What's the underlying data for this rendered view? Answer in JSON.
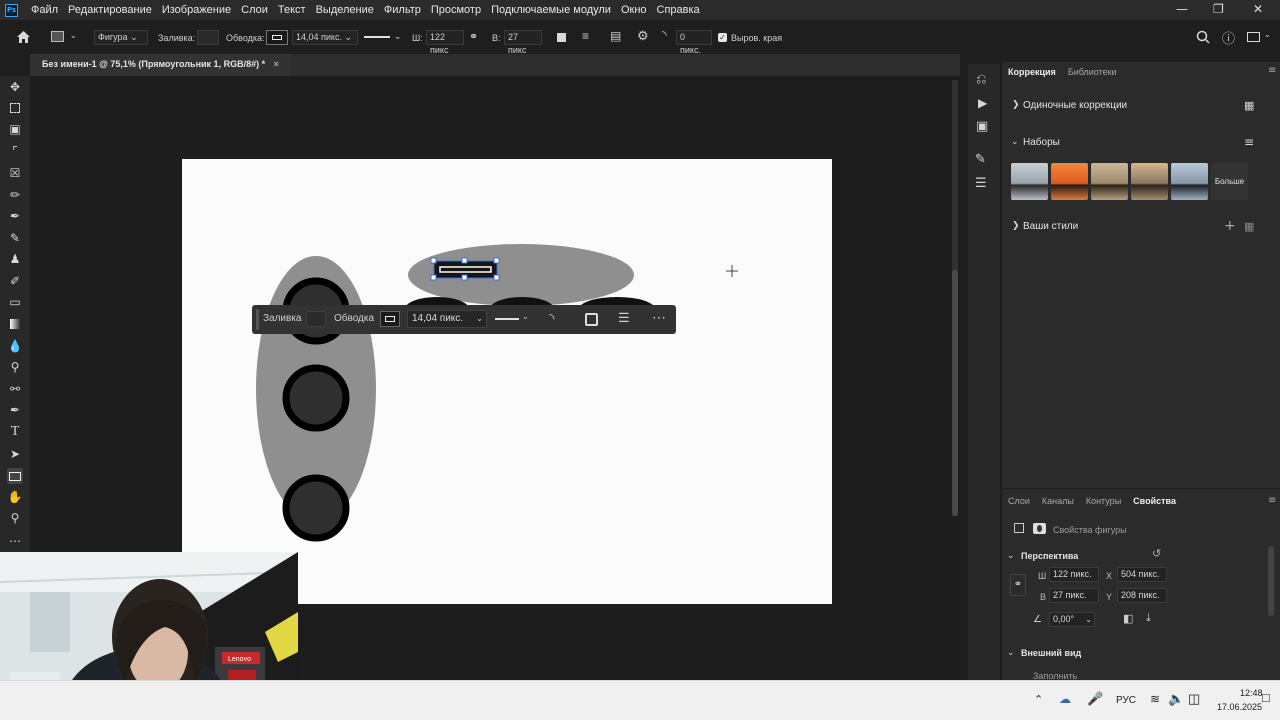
{
  "app": {
    "logo": "Ps"
  },
  "menu": [
    "Файл",
    "Редактирование",
    "Изображение",
    "Слои",
    "Текст",
    "Выделение",
    "Фильтр",
    "Просмотр",
    "Подключаемые модули",
    "Окно",
    "Справка"
  ],
  "options_bar": {
    "shape_mode": "Фигура",
    "fill_label": "Заливка:",
    "stroke_label": "Обводка:",
    "stroke_width": "14,04 пикс.",
    "w_label": "Ш:",
    "w_value": "122 пикс",
    "h_label": "В:",
    "h_value": "27 пикс",
    "radius_value": "0 пикс.",
    "align_edges_label": "Выров. края"
  },
  "document_tab": {
    "title": "Без имени-1 @ 75,1% (Прямоугольник 1, RGB/8#) *",
    "close": "×"
  },
  "context_bar": {
    "fill_label": "Заливка",
    "stroke_label": "Обводка",
    "stroke_width": "14,04 пикс."
  },
  "panel_top": {
    "tabs": [
      "Коррекция",
      "Библиотеки"
    ],
    "single_corrections": "Одиночные коррекции",
    "presets": "Наборы",
    "more": "Больше",
    "your_styles": "Ваши стили"
  },
  "panel_bottom": {
    "tabs": [
      "Слои",
      "Каналы",
      "Контуры",
      "Свойства"
    ],
    "shape_properties": "Свойства фигуры",
    "perspective": "Перспектива",
    "w_label": "Ш",
    "w_value": "122 пикс.",
    "x_label": "X",
    "x_value": "504 пикс.",
    "h_label": "В",
    "h_value": "27 пикс.",
    "y_label": "Y",
    "y_value": "208 пикс.",
    "angle_value": "0,00°",
    "appearance": "Внешний вид",
    "fill": "Заполнить"
  },
  "taskbar": {
    "lang": "РУС",
    "time": "12:48",
    "date": "17.06.2025"
  },
  "webcam": {
    "brand_sign": "Lenovo"
  },
  "colors": {
    "accent": "#31a8ff",
    "canvas": "#fbfbfb",
    "shape_gray": "#8f8f8f",
    "circle_fill": "#2f2f2f"
  }
}
